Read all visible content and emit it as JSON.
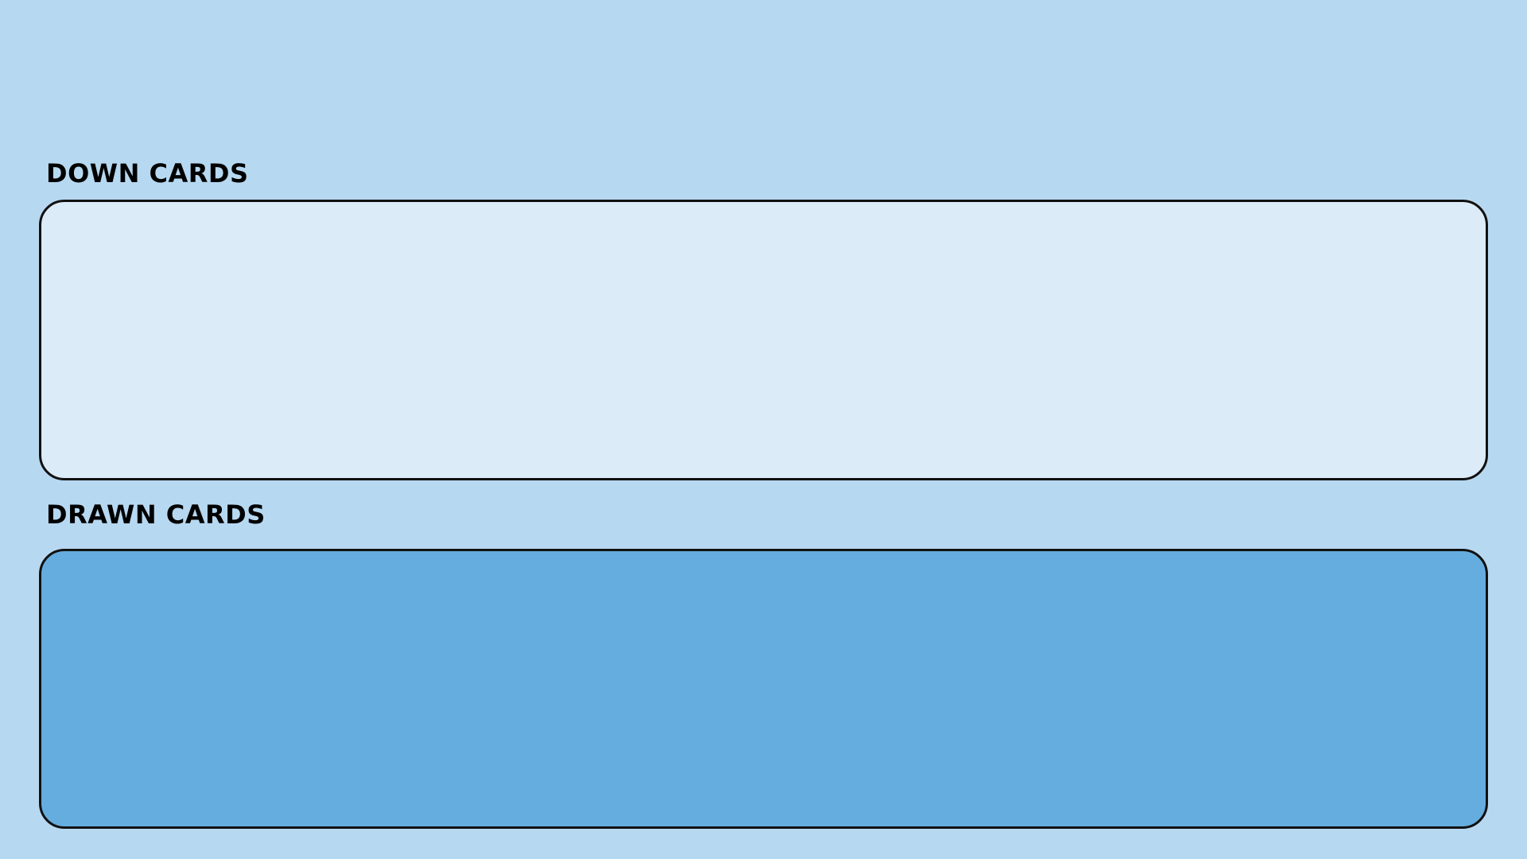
{
  "sections": {
    "down_cards": {
      "label": "DOWN CARDS",
      "cards": []
    },
    "drawn_cards": {
      "label": "DRAWN CARDS",
      "cards": []
    }
  },
  "colors": {
    "background": "#b7d8f1",
    "down_zone": "#dcebf8",
    "drawn_zone": "#66addf",
    "border": "#111111",
    "text": "#000000"
  }
}
